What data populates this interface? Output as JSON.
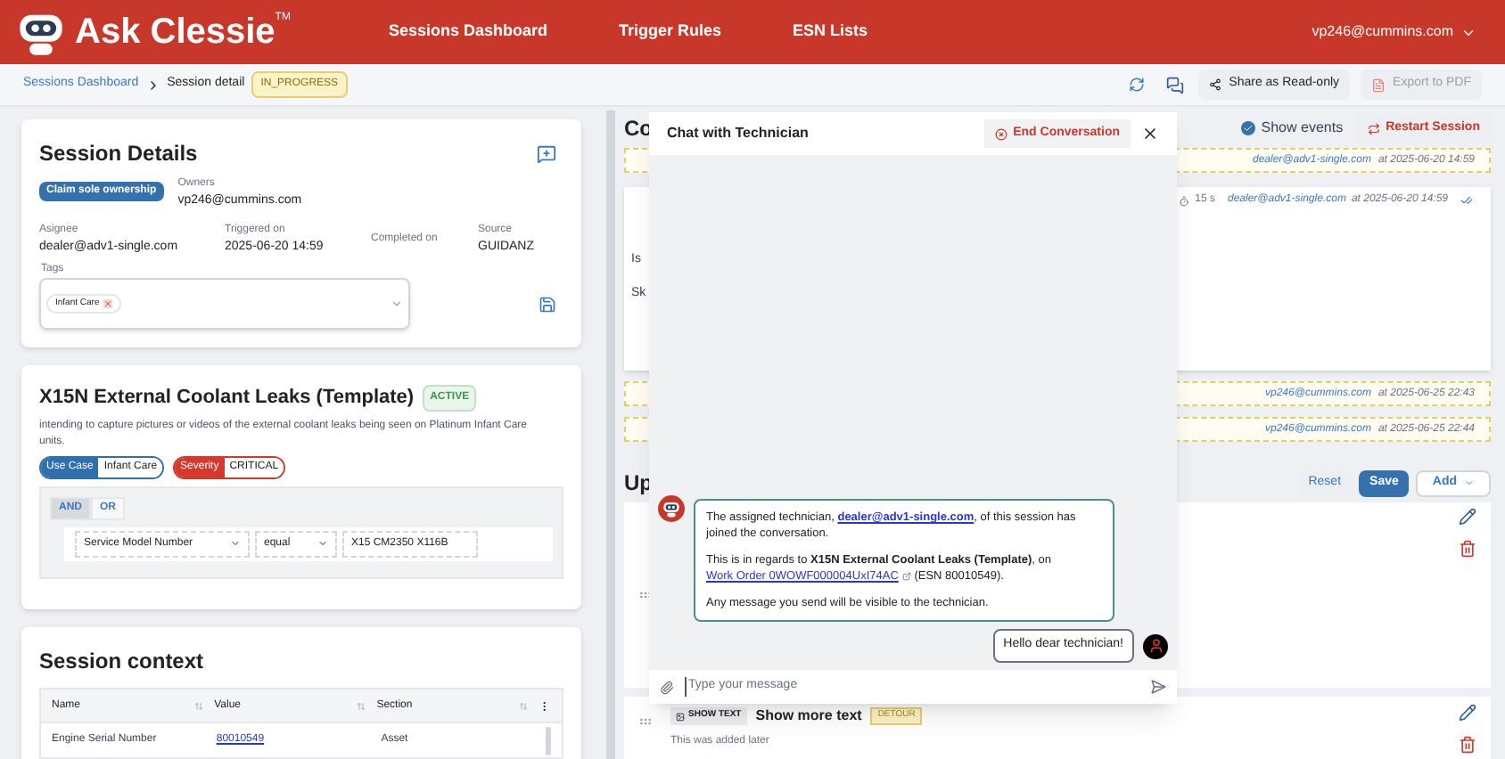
{
  "header": {
    "logo": "Ask Clessie",
    "logo_mark": "TM",
    "nav": [
      {
        "label": "Sessions Dashboard"
      },
      {
        "label": "Trigger Rules"
      },
      {
        "label": "ESN Lists"
      }
    ],
    "user": "vp246@cummins.com"
  },
  "breadcrumb": {
    "link": "Sessions Dashboard",
    "current": "Session detail",
    "status": "IN_PROGRESS"
  },
  "toolbar": {
    "share": "Share as Read-only",
    "export": {
      "label": "Export to PDF",
      "disabled": true
    }
  },
  "session_details": {
    "title": "Session Details",
    "claim": "Claim sole ownership",
    "owners_label": "Owners",
    "owners": "vp246@cummins.com",
    "fields": [
      {
        "label": "Asignee",
        "value": "dealer@adv1-single.com"
      },
      {
        "label": "Triggered on",
        "value": "2025-06-20 14:59"
      },
      {
        "label": "Completed on"
      },
      {
        "label": "Source",
        "value": "GUIDANZ"
      }
    ],
    "tags_label": "Tags",
    "tags": [
      "Infant Care"
    ]
  },
  "template": {
    "title": "X15N External Coolant Leaks (Template)",
    "status": "ACTIVE",
    "description": "intending to capture pictures or videos of the external coolant leaks being seen on Platinum Infant Care units.",
    "chips": [
      {
        "key": "Use Case",
        "value": "Infant Care",
        "color": "#2f6fae"
      },
      {
        "key": "Severity",
        "value": "CRITICAL",
        "color": "#d33a2c"
      }
    ],
    "logic": [
      {
        "label": "AND",
        "selected": true
      },
      {
        "label": "OR",
        "selected": false
      }
    ],
    "rule": {
      "field": "Service Model Number",
      "operator": "equal",
      "value": "X15 CM2350 X116B"
    }
  },
  "session_context": {
    "title": "Session context",
    "columns": [
      "Name",
      "Value",
      "Section"
    ],
    "rows": [
      {
        "name": "Engine Serial Number",
        "value": "80010549",
        "section": "Asset"
      }
    ]
  },
  "conversation": {
    "heading": "Co",
    "show_events": {
      "label": "Show events",
      "checked": true
    },
    "restart": "Restart Session",
    "events": [
      {
        "user": "dealer@adv1-single.com",
        "when": "at 2025-06-20 14:59"
      }
    ],
    "card": {
      "fragments": [
        "Is",
        "Sk"
      ],
      "duration": "15 s",
      "user": "dealer@adv1-single.com",
      "when": "at 2025-06-20 14:59"
    },
    "events_after": [
      {
        "user": "vp246@cummins.com",
        "when": "at 2025-06-25 22:43"
      },
      {
        "user": "vp246@cummins.com",
        "when": "at 2025-06-25 22:44"
      }
    ]
  },
  "updates": {
    "heading": "Up",
    "reset": "Reset",
    "save": "Save",
    "add": "Add",
    "item": {
      "button": "SHOW TEXT",
      "title": "Show more text",
      "tag": "DETOUR",
      "note": "This was added later"
    }
  },
  "chat": {
    "title": "Chat with Technician",
    "end": "End Conversation",
    "message": [
      [
        {
          "kind": "text",
          "text": "The assigned technician, "
        },
        {
          "kind": "link",
          "text": "dealer@adv1-single.com"
        },
        {
          "kind": "text",
          "text": ", of this session has joined the conversation."
        }
      ],
      [
        {
          "kind": "text",
          "text": "This is in regards to **X15N External Coolant Leaks (Template)**, on "
        },
        {
          "kind": "external",
          "text": "Work Order 0WOWF000004UxI74AC"
        },
        {
          "kind": "text",
          "text": " (ESN 80010549)."
        }
      ],
      [
        {
          "kind": "text",
          "text": "Any message you send will be visible to the technician."
        }
      ]
    ],
    "reply": "Hello dear technician!",
    "placeholder": "Type your message"
  }
}
